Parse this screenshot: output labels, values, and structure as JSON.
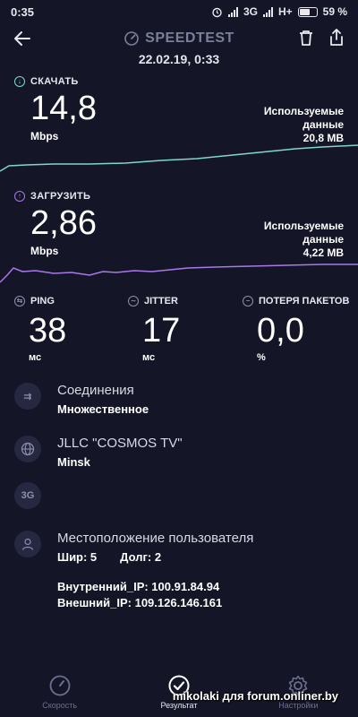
{
  "status_bar": {
    "time": "0:35",
    "network": "3G",
    "network2": "H+",
    "battery": "59 %",
    "battery_level": 0.59
  },
  "header": {
    "title": "SPEEDTEST",
    "datetime": "22.02.19, 0:33"
  },
  "download": {
    "label": "СКАЧАТЬ",
    "value": "14,8",
    "unit": "Mbps",
    "data_label_1": "Используемые",
    "data_label_2": "данные",
    "data_value": "20,8 MB",
    "color": "#7fd6cf"
  },
  "upload": {
    "label": "ЗАГРУЗИТЬ",
    "value": "2,86",
    "unit": "Mbps",
    "data_label_1": "Используемые",
    "data_label_2": "данные",
    "data_value": "4,22 MB",
    "color": "#a879e8"
  },
  "ping": {
    "label": "PING",
    "value": "38",
    "unit": "мс"
  },
  "jitter": {
    "label": "JITTER",
    "value": "17",
    "unit": "мс"
  },
  "loss": {
    "label": "ПОТЕРЯ ПАКЕТОВ",
    "value": "0,0",
    "unit": "%"
  },
  "connections": {
    "title": "Соединения",
    "value": "Множественное"
  },
  "provider": {
    "title": "JLLC \"COSMOS TV\"",
    "value": "Minsk"
  },
  "network_type": {
    "icon_text": "3G"
  },
  "location": {
    "title": "Местоположение пользователя",
    "lat_label": "Шир: 5",
    "lon_label": "Долг: 2",
    "internal_ip": "Внутренний_IP: 100.91.84.94",
    "external_ip": "Внешний_IP: 109.126.146.161"
  },
  "nav": {
    "speed": "Скорость",
    "result": "Результат",
    "settings": "Настройки"
  },
  "watermark": "mikolaki для forum.onliner.by"
}
